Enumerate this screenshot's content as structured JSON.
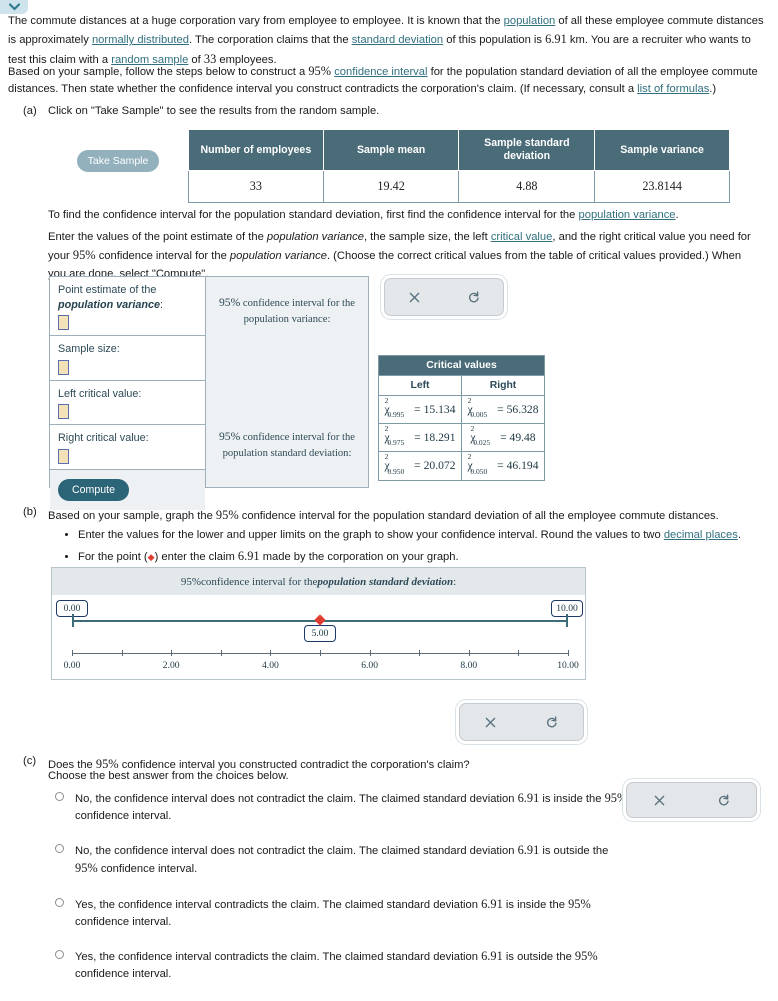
{
  "top_tab": {
    "icon": "chevron-down-icon"
  },
  "intro": {
    "p1_before_pop": "The commute distances at a huge corporation vary from employee to employee. It is known that the ",
    "link_population": "population",
    "p1_mid1": " of all these employee commute distances is approximately ",
    "link_normal": "normally distributed",
    "p1_mid2": ". The corporation claims that the ",
    "link_sd": "standard deviation",
    "p1_mid3": " of this population is ",
    "claimed_sd": "6.91",
    "p1_mid4": " km. You are a recruiter who wants to test this claim with a ",
    "link_random_sample": "random sample",
    "p1_mid5": " of ",
    "sample_n": "33",
    "p1_end": " employees.",
    "p2_before": "Based on your sample, follow the steps below to construct a ",
    "confidence_level": "95%",
    "link_ci": "confidence interval",
    "p2_mid": " for the population standard deviation of all the employee commute distances. Then state whether the confidence interval you construct contradicts the corporation's claim. (If necessary, consult a ",
    "link_formulas": "list of formulas",
    "p2_end": ".)"
  },
  "part_a": {
    "label": "(a)",
    "text": "Click on \"Take Sample\" to see the results from the random sample.",
    "take_sample_button": "Take Sample",
    "table": {
      "headers": [
        "Number of employees",
        "Sample mean",
        "Sample standard deviation",
        "Sample variance"
      ],
      "values": [
        "33",
        "19.42",
        "4.88",
        "23.8144"
      ]
    },
    "instr1_before": "To find the confidence interval for the population standard deviation, first find the confidence interval for the ",
    "instr1_link": "population variance",
    "instr1_after": ".",
    "instr2_a": "Enter the values of the point estimate of the ",
    "instr2_italic1": "population variance",
    "instr2_b": ", the sample size, the left ",
    "instr2_link": "critical value",
    "instr2_c": ", and the right critical value you need for your ",
    "instr2_pct": "95%",
    "instr2_d": " confidence interval for the ",
    "instr2_italic2": "population variance",
    "instr2_e": ". (Choose the correct critical values from the table of critical values provided.) When you are done, select \"Compute\"."
  },
  "compute_panel": {
    "fields": [
      {
        "label_a": "Point estimate of the",
        "label_b": "population variance",
        "label_c": ":",
        "value": ""
      },
      {
        "label_a": "Sample size:",
        "label_b": "",
        "label_c": "",
        "value": ""
      },
      {
        "label_a": "Left critical value:",
        "label_b": "",
        "label_c": "",
        "value": ""
      },
      {
        "label_a": "Right critical value:",
        "label_b": "",
        "label_c": "",
        "value": ""
      }
    ],
    "compute_button": "Compute",
    "result_variance_pct": "95%",
    "result_variance_text": " confidence interval for the population variance:",
    "result_sd_pct": "95%",
    "result_sd_text": " confidence interval for the population standard deviation:"
  },
  "controls": {
    "close_icon": "close-icon",
    "reset_icon": "reset-icon"
  },
  "critical_values": {
    "title": "Critical values",
    "col_left": "Left",
    "col_right": "Right",
    "rows": [
      {
        "left_sub": "0.995",
        "left_val": "15.134",
        "right_sub": "0.005",
        "right_val": "56.328"
      },
      {
        "left_sub": "0.975",
        "left_val": "18.291",
        "right_sub": "0.025",
        "right_val": "49.48"
      },
      {
        "left_sub": "0.950",
        "left_val": "20.072",
        "right_sub": "0.050",
        "right_val": "46.194"
      }
    ],
    "symbol": "χ",
    "exponent": "2",
    "equals": "="
  },
  "part_b": {
    "label": "(b)",
    "intro_a": "Based on your sample, graph the ",
    "intro_pct": "95%",
    "intro_b": " confidence interval for the population standard deviation of all the employee commute distances.",
    "bullet1_a": "Enter the values for the lower and upper limits on the graph to show your confidence interval. Round the values to two ",
    "bullet1_link": "decimal places",
    "bullet1_b": ".",
    "bullet2_a": "For the point (",
    "bullet2_diamond": "◆",
    "bullet2_b": ") enter the claim ",
    "bullet2_claim": "6.91",
    "bullet2_c": " made by the corporation on your graph."
  },
  "chart_data": {
    "type": "interval",
    "title_pct": "95%",
    "title_a": " confidence interval for the ",
    "title_bold": "population standard deviation",
    "title_b": ":",
    "lower_limit": "0.00",
    "upper_limit": "10.00",
    "point_value": "5.00",
    "point_marker_color": "#e03c31",
    "line_color": "#3d6b77",
    "xlim": [
      0,
      10
    ],
    "tick_step": 1,
    "ticks": [
      0,
      1,
      2,
      3,
      4,
      5,
      6,
      7,
      8,
      9,
      10
    ],
    "tick_labels": [
      "0.00",
      "",
      "2.00",
      "",
      "4.00",
      "",
      "6.00",
      "",
      "8.00",
      "",
      "10.00"
    ]
  },
  "part_c": {
    "label": "(c)",
    "question_a": "Does the ",
    "question_pct": "95%",
    "question_b": " confidence interval you constructed contradict the corporation's claim?",
    "question_line2": "Choose the best answer from the choices below.",
    "choices": [
      {
        "a": "No, the confidence interval does not contradict the claim. The claimed standard deviation ",
        "val": "6.91",
        "b": " is inside the ",
        "pct": "95%",
        "c": " confidence interval."
      },
      {
        "a": "No, the confidence interval does not contradict the claim. The claimed standard deviation ",
        "val": "6.91",
        "b": " is outside the ",
        "pct": "95%",
        "c": " confidence interval."
      },
      {
        "a": "Yes, the confidence interval contradicts the claim. The claimed standard deviation ",
        "val": "6.91",
        "b": " is inside the ",
        "pct": "95%",
        "c": " confidence interval."
      },
      {
        "a": "Yes, the confidence interval contradicts the claim. The claimed standard deviation ",
        "val": "6.91",
        "b": " is outside the ",
        "pct": "95%",
        "c": " confidence interval."
      }
    ]
  }
}
